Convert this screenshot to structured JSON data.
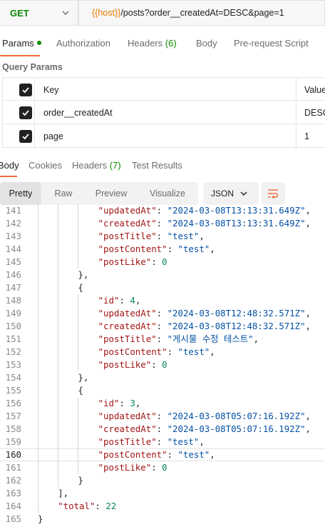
{
  "request": {
    "method": "GET",
    "url_var": "{{host}}",
    "url_rest": "/posts?order__createdAt=DESC&page=1"
  },
  "request_tabs": {
    "params": "Params",
    "authorization": "Authorization",
    "headers": "Headers",
    "headers_count": "(6)",
    "body": "Body",
    "prerequest": "Pre-request Script"
  },
  "query_params": {
    "title": "Query Params",
    "header_key": "Key",
    "header_value": "Value",
    "rows": [
      {
        "key": "order__createdAt",
        "value": "DESC"
      },
      {
        "key": "page",
        "value": "1"
      }
    ]
  },
  "response_tabs": {
    "body": "Body",
    "cookies": "Cookies",
    "headers": "Headers",
    "headers_count": "(7)",
    "test_results": "Test Results"
  },
  "view": {
    "pretty": "Pretty",
    "raw": "Raw",
    "preview": "Preview",
    "visualize": "Visualize",
    "format": "JSON"
  },
  "code_lines": [
    {
      "n": "141",
      "indent": 6,
      "kind": "kv",
      "key": "\"updatedAt\"",
      "sep": ": ",
      "val": "\"2024-03-08T13:13:31.649Z\"",
      "vt": "s",
      "tail": ","
    },
    {
      "n": "142",
      "indent": 6,
      "kind": "kv",
      "key": "\"createdAt\"",
      "sep": ": ",
      "val": "\"2024-03-08T13:13:31.649Z\"",
      "vt": "s",
      "tail": ","
    },
    {
      "n": "143",
      "indent": 6,
      "kind": "kv",
      "key": "\"postTitle\"",
      "sep": ": ",
      "val": "\"test\"",
      "vt": "s",
      "tail": ","
    },
    {
      "n": "144",
      "indent": 6,
      "kind": "kv",
      "key": "\"postContent\"",
      "sep": ": ",
      "val": "\"test\"",
      "vt": "s",
      "tail": ","
    },
    {
      "n": "145",
      "indent": 6,
      "kind": "kv",
      "key": "\"postLike\"",
      "sep": ": ",
      "val": "0",
      "vt": "n",
      "tail": ""
    },
    {
      "n": "146",
      "indent": 4,
      "kind": "p",
      "text": "},"
    },
    {
      "n": "147",
      "indent": 4,
      "kind": "p",
      "text": "{"
    },
    {
      "n": "148",
      "indent": 6,
      "kind": "kv",
      "key": "\"id\"",
      "sep": ": ",
      "val": "4",
      "vt": "n",
      "tail": ","
    },
    {
      "n": "149",
      "indent": 6,
      "kind": "kv",
      "key": "\"updatedAt\"",
      "sep": ": ",
      "val": "\"2024-03-08T12:48:32.571Z\"",
      "vt": "s",
      "tail": ","
    },
    {
      "n": "150",
      "indent": 6,
      "kind": "kv",
      "key": "\"createdAt\"",
      "sep": ": ",
      "val": "\"2024-03-08T12:48:32.571Z\"",
      "vt": "s",
      "tail": ","
    },
    {
      "n": "151",
      "indent": 6,
      "kind": "kv",
      "key": "\"postTitle\"",
      "sep": ": ",
      "val": "\"게시물 수정 테스트\"",
      "vt": "s",
      "tail": ","
    },
    {
      "n": "152",
      "indent": 6,
      "kind": "kv",
      "key": "\"postContent\"",
      "sep": ": ",
      "val": "\"test\"",
      "vt": "s",
      "tail": ","
    },
    {
      "n": "153",
      "indent": 6,
      "kind": "kv",
      "key": "\"postLike\"",
      "sep": ": ",
      "val": "0",
      "vt": "n",
      "tail": ""
    },
    {
      "n": "154",
      "indent": 4,
      "kind": "p",
      "text": "},"
    },
    {
      "n": "155",
      "indent": 4,
      "kind": "p",
      "text": "{"
    },
    {
      "n": "156",
      "indent": 6,
      "kind": "kv",
      "key": "\"id\"",
      "sep": ": ",
      "val": "3",
      "vt": "n",
      "tail": ","
    },
    {
      "n": "157",
      "indent": 6,
      "kind": "kv",
      "key": "\"updatedAt\"",
      "sep": ": ",
      "val": "\"2024-03-08T05:07:16.192Z\"",
      "vt": "s",
      "tail": ","
    },
    {
      "n": "158",
      "indent": 6,
      "kind": "kv",
      "key": "\"createdAt\"",
      "sep": ": ",
      "val": "\"2024-03-08T05:07:16.192Z\"",
      "vt": "s",
      "tail": ","
    },
    {
      "n": "159",
      "indent": 6,
      "kind": "kv",
      "key": "\"postTitle\"",
      "sep": ": ",
      "val": "\"test\"",
      "vt": "s",
      "tail": ","
    },
    {
      "n": "160",
      "indent": 6,
      "kind": "kv",
      "key": "\"postContent\"",
      "sep": ": ",
      "val": "\"test\"",
      "vt": "s",
      "tail": ",",
      "active": true
    },
    {
      "n": "161",
      "indent": 6,
      "kind": "kv",
      "key": "\"postLike\"",
      "sep": ": ",
      "val": "0",
      "vt": "n",
      "tail": ""
    },
    {
      "n": "162",
      "indent": 4,
      "kind": "p",
      "text": "}"
    },
    {
      "n": "163",
      "indent": 2,
      "kind": "p",
      "text": "],"
    },
    {
      "n": "164",
      "indent": 2,
      "kind": "kv",
      "key": "\"total\"",
      "sep": ": ",
      "val": "22",
      "vt": "n",
      "tail": ""
    },
    {
      "n": "165",
      "indent": 0,
      "kind": "p",
      "text": "}"
    }
  ]
}
